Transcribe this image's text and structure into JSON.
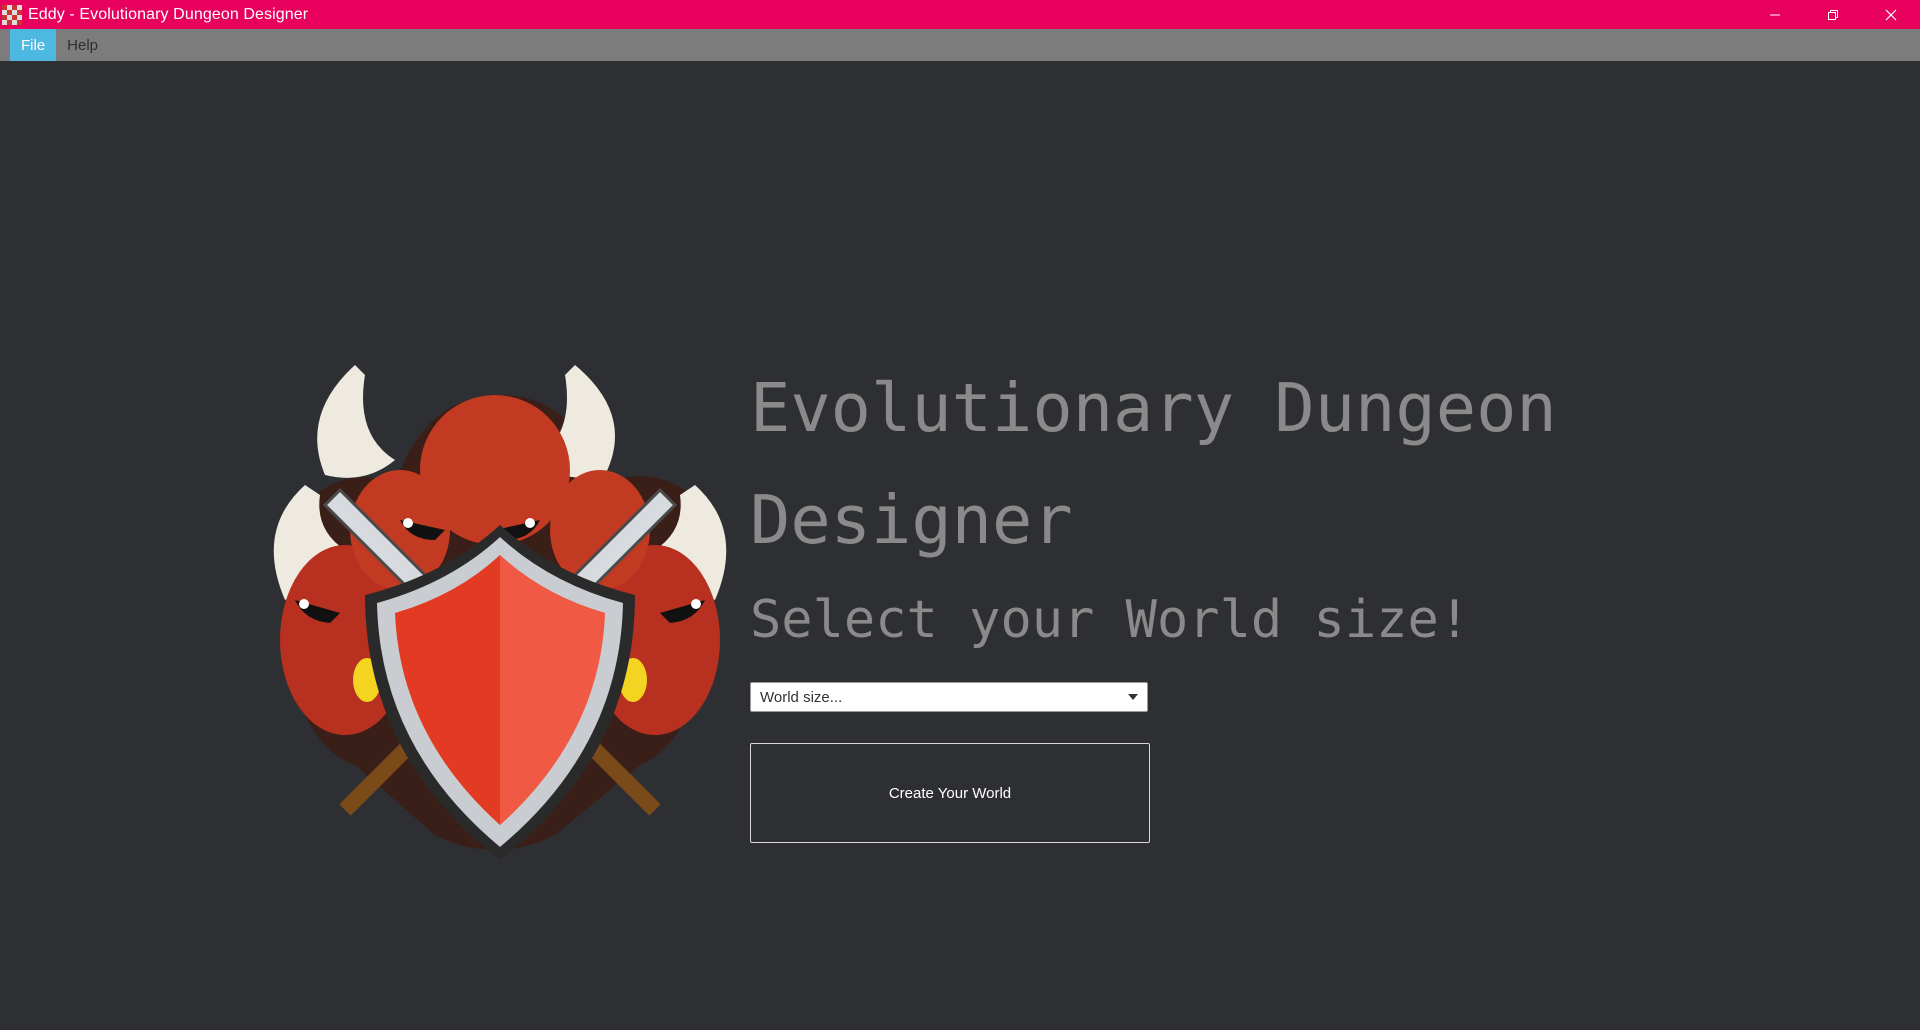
{
  "window": {
    "title": "Eddy - Evolutionary Dungeon Designer",
    "icon": "eddy-app-icon",
    "controls": [
      "minimize-icon",
      "restore-icon",
      "close-icon"
    ]
  },
  "menubar": {
    "items": [
      {
        "label": "File",
        "active": true
      },
      {
        "label": "Help",
        "active": false
      }
    ]
  },
  "main": {
    "logo": "horned-demon-shield-logo",
    "headline": "Evolutionary Dungeon Designer",
    "subtitle": "Select your World size!",
    "world_size_select": {
      "placeholder": "World size..."
    },
    "create_button_label": "Create Your World"
  },
  "colors": {
    "titlebar": "#e8005d",
    "menubar": "#7c7c7c",
    "menu_active": "#4db8e0",
    "background": "#2d2f33",
    "heading_text": "#8a8a8a"
  }
}
